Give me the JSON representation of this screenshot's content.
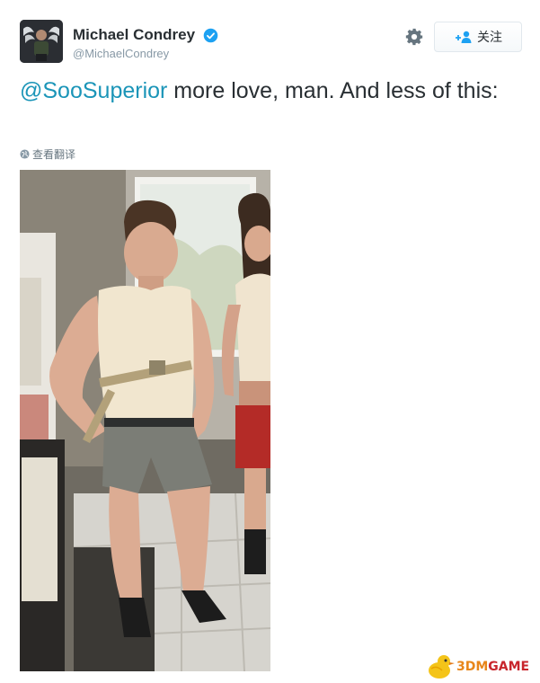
{
  "tweet": {
    "author": {
      "display_name": "Michael Condrey",
      "handle": "@MichaelCondrey",
      "verified": true
    },
    "follow_label": "关注",
    "text_mention": "@SooSuperior",
    "text_body": " more love, man. And less of this:",
    "translate_label": "查看翻译",
    "icons": [
      "verified-badge-icon",
      "gear-icon",
      "follow-person-icon",
      "globe-icon"
    ]
  },
  "watermark": {
    "part1": "3DM",
    "part2": "GAME"
  },
  "colors": {
    "mention": "#1b95b8",
    "verified": "#1da1f2",
    "text": "#292f33",
    "secondary": "#8899a6"
  }
}
